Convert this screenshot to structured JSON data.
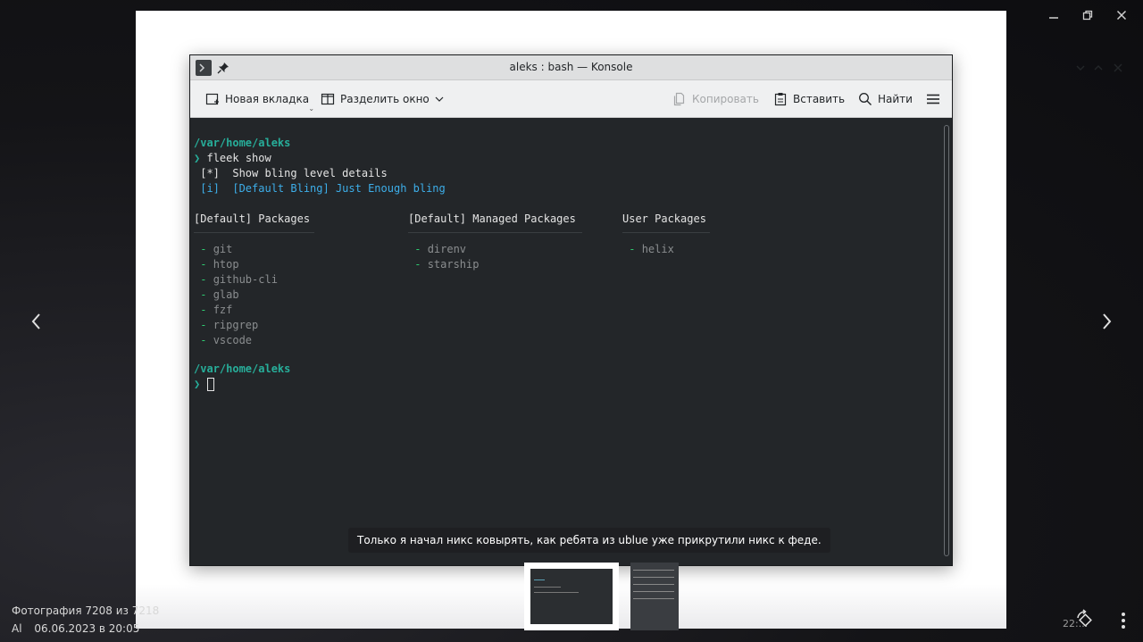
{
  "viewer": {
    "footer_title": "Фотография 7208 из 7218",
    "author": "Al",
    "date": "06.06.2023 в 20:05",
    "tray_time": "22:..."
  },
  "window": {
    "title": "aleks : bash — Konsole"
  },
  "toolbar": {
    "new_tab": "Новая вкладка",
    "split": "Разделить окно",
    "copy": "Копировать",
    "paste": "Вставить",
    "find": "Найти"
  },
  "terminal": {
    "path1": "/var/home/aleks",
    "prompt_symbol": "❯",
    "command": "fleek show",
    "line_star": " [*]  Show bling level details",
    "line_info": " [i]  [Default Bling] Just Enough bling",
    "col1_title": "[Default] Packages",
    "col2_title": "[Default] Managed Packages",
    "col3_title": "User Packages",
    "col1_items": [
      "git",
      "htop",
      "github-cli",
      "glab",
      "fzf",
      "ripgrep",
      "vscode"
    ],
    "col2_items": [
      "direnv",
      "starship"
    ],
    "col3_items": [
      "helix"
    ],
    "path2": "/var/home/aleks"
  },
  "caption": "Только я начал никс ковырять, как ребята из ublue уже прикрутили  никс к феде.",
  "colors": {
    "accent_teal": "#27ae9a",
    "info_blue": "#3daee9",
    "terminal_bg": "#232629"
  }
}
